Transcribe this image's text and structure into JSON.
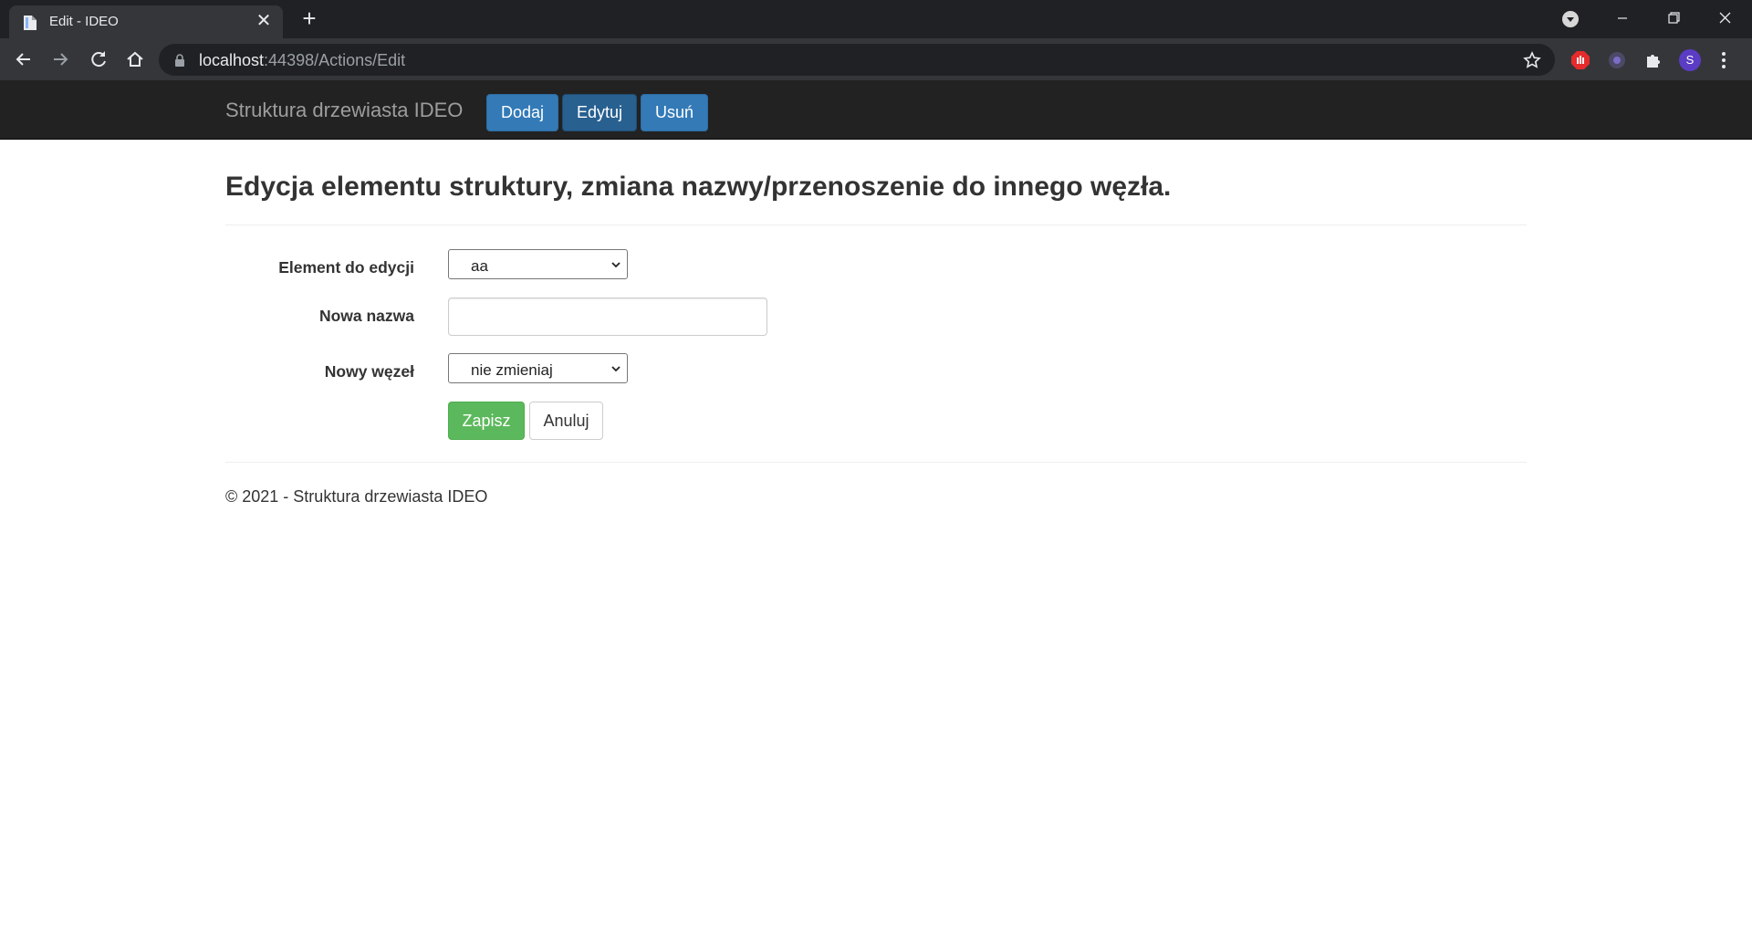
{
  "browser": {
    "tab_title": "Edit - IDEO",
    "url_host": "localhost",
    "url_path": ":44398/Actions/Edit",
    "avatar_letter": "S"
  },
  "navbar": {
    "brand": "Struktura drzewiasta IDEO",
    "items": [
      {
        "label": "Dodaj",
        "active": false
      },
      {
        "label": "Edytuj",
        "active": true
      },
      {
        "label": "Usuń",
        "active": false
      }
    ]
  },
  "page": {
    "heading": "Edycja elementu struktury, zmiana nazwy/przenoszenie do innego węzła.",
    "form": {
      "element_label": "Element do edycji",
      "element_value": "aa",
      "new_name_label": "Nowa nazwa",
      "new_name_value": "",
      "new_node_label": "Nowy węzeł",
      "new_node_value": "nie zmieniaj",
      "save_label": "Zapisz",
      "cancel_label": "Anuluj"
    },
    "footer": "© 2021 - Struktura drzewiasta IDEO"
  },
  "colors": {
    "navbar_bg": "#222222",
    "primary": "#337ab7",
    "success": "#5cb85c"
  }
}
